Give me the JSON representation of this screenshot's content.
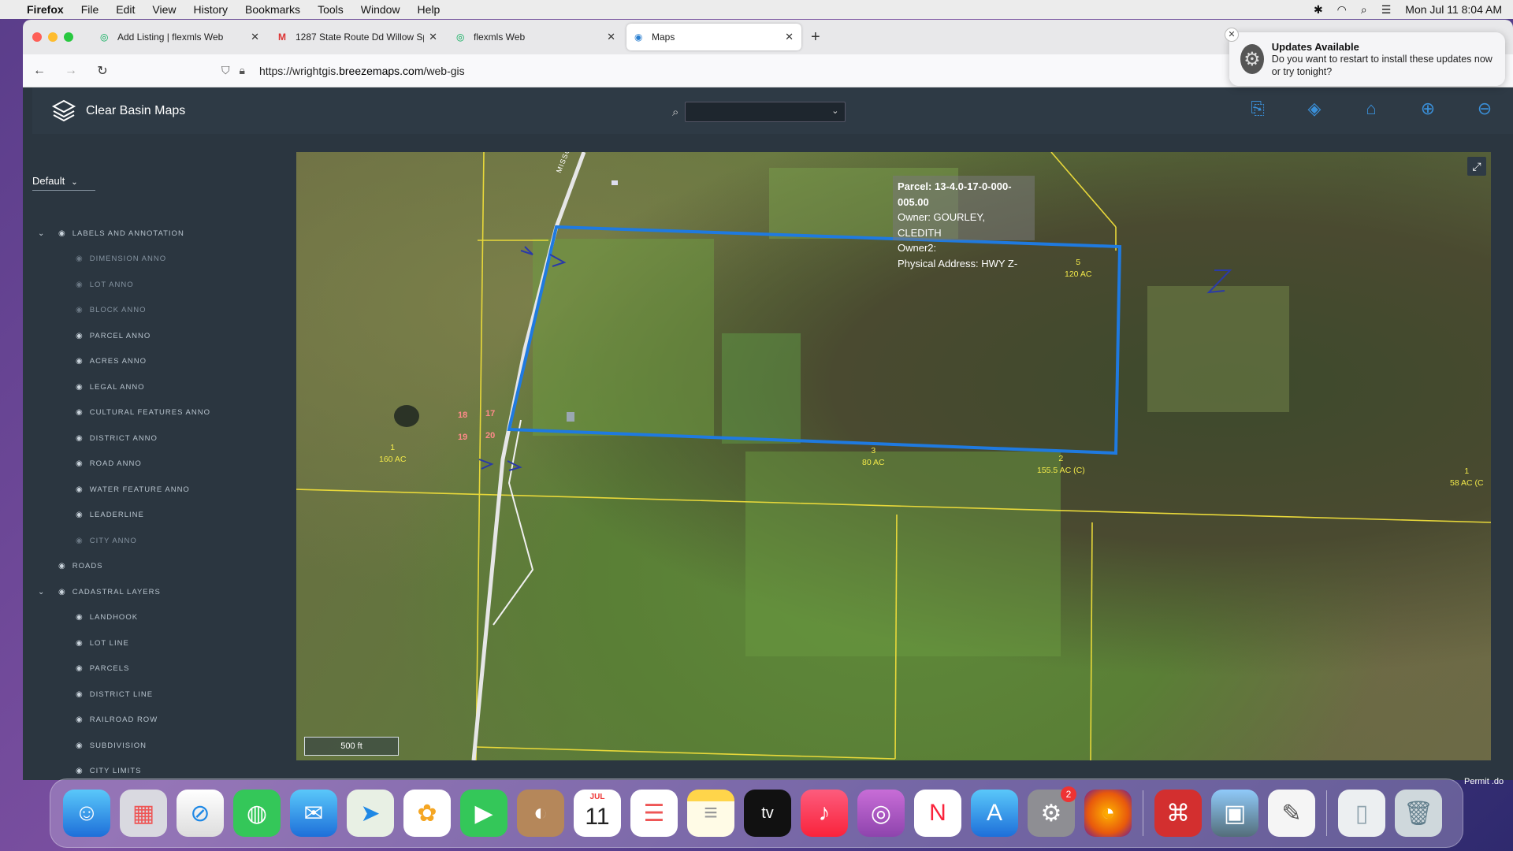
{
  "menubar": {
    "app": "Firefox",
    "items": [
      "File",
      "Edit",
      "View",
      "History",
      "Bookmarks",
      "Tools",
      "Window",
      "Help"
    ],
    "datetime": "Mon Jul 11  8:04 AM"
  },
  "browser": {
    "tabs": [
      {
        "title": "Add Listing | flexmls Web",
        "icon": "flexmls-icon"
      },
      {
        "title": "1287 State Route Dd Willow Spr",
        "icon": "gmail-icon"
      },
      {
        "title": "flexmls Web",
        "icon": "flexmls-icon"
      },
      {
        "title": "Maps",
        "icon": "globe-icon"
      }
    ],
    "url_prefix": "https://wrightgis.",
    "url_domain": "breezemaps.com",
    "url_path": "/web-gis"
  },
  "notification": {
    "title": "Updates Available",
    "body": "Do you want to restart to install these updates now or try tonight?"
  },
  "app": {
    "title": "Clear Basin Maps",
    "search_value": ""
  },
  "leftpanel": {
    "preset": "Default",
    "layers": [
      {
        "label": "LABELS AND ANNOTATION",
        "group": true,
        "expanded": true,
        "visible": true
      },
      {
        "label": "DIMENSION ANNO",
        "visible": false
      },
      {
        "label": "LOT ANNO",
        "visible": false
      },
      {
        "label": "BLOCK ANNO",
        "visible": false
      },
      {
        "label": "PARCEL ANNO",
        "visible": true
      },
      {
        "label": "ACRES ANNO",
        "visible": true
      },
      {
        "label": "LEGAL ANNO",
        "visible": true
      },
      {
        "label": "CULTURAL FEATURES ANNO",
        "visible": true
      },
      {
        "label": "DISTRICT ANNO",
        "visible": true
      },
      {
        "label": "ROAD ANNO",
        "visible": true
      },
      {
        "label": "WATER FEATURE ANNO",
        "visible": true
      },
      {
        "label": "LEADERLINE",
        "visible": true
      },
      {
        "label": "CITY ANNO",
        "visible": false
      },
      {
        "label": "ROADS",
        "group": true,
        "expanded": false,
        "visible": true,
        "noChevron": true
      },
      {
        "label": "CADASTRAL LAYERS",
        "group": true,
        "expanded": true,
        "visible": true
      },
      {
        "label": "LANDHOOK",
        "visible": true
      },
      {
        "label": "LOT LINE",
        "visible": true
      },
      {
        "label": "PARCELS",
        "visible": true
      },
      {
        "label": "DISTRICT LINE",
        "visible": true
      },
      {
        "label": "RAILROAD ROW",
        "visible": true
      },
      {
        "label": "SUBDIVISION",
        "visible": true
      },
      {
        "label": "CITY LIMITS",
        "visible": true
      }
    ]
  },
  "map": {
    "popup": {
      "parcel": "Parcel: 13-4.0-17-0-000-005.00",
      "owner": "Owner: GOURLEY, CLEDITH",
      "owner2": "Owner2:",
      "address": "Physical Address: HWY Z-"
    },
    "road_label": "MISSOURI",
    "parcel_labels": [
      {
        "num": "5",
        "acres": "120 AC"
      },
      {
        "num": "1",
        "acres": "160 AC"
      },
      {
        "num": "3",
        "acres": "80 AC"
      },
      {
        "num": "2",
        "acres": "155.5 AC (C)"
      },
      {
        "num": "1",
        "acres": "58 AC (C"
      }
    ],
    "section_labels": [
      "18",
      "17",
      "19",
      "20"
    ],
    "scale": "500 ft"
  },
  "dock": {
    "calendar_month": "JUL",
    "calendar_day": "11",
    "settings_badge": "2",
    "corner_text": "Permit .do"
  },
  "colors": {
    "parcel_outline": "#1f7ae0",
    "parcel_lines": "#e8d83a",
    "accent": "#3a8fd8"
  }
}
